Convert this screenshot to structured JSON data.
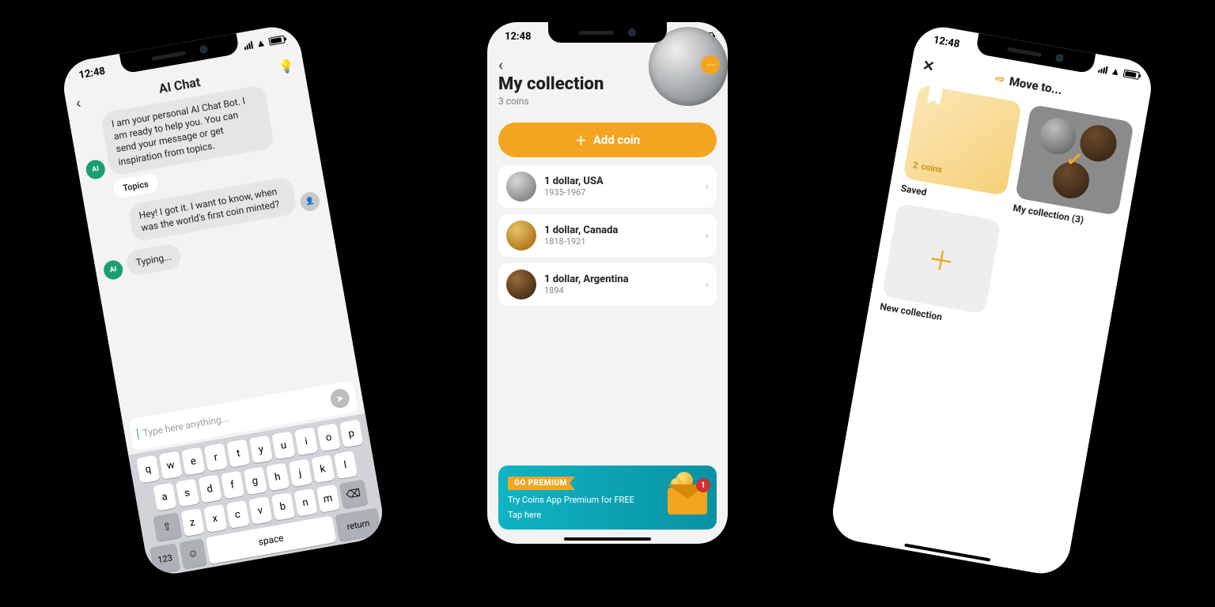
{
  "status_time": "12:48",
  "phone1": {
    "title": "AI Chat",
    "bot_intro": "I am your personal AI Chat Bot. I am ready to help you. You can send your message or get inspiration from topics.",
    "topics_label": "Topics",
    "user_msg": "Hey! I got it. I want to know, when was the world's first coin minted?",
    "typing": "Typing...",
    "placeholder": "Type here anything...",
    "avatar_label": "AI",
    "kb": {
      "row1": [
        "q",
        "w",
        "e",
        "r",
        "t",
        "y",
        "u",
        "i",
        "o",
        "p"
      ],
      "row2": [
        "a",
        "s",
        "d",
        "f",
        "g",
        "h",
        "j",
        "k",
        "l"
      ],
      "row3": [
        "z",
        "x",
        "c",
        "v",
        "b",
        "n",
        "m"
      ],
      "num": "123",
      "space": "space",
      "return": "return"
    }
  },
  "phone2": {
    "title": "My collection",
    "subtitle": "3 coins",
    "add_label": "Add coin",
    "coins": [
      {
        "name": "1 dollar, USA",
        "range": "1935-1967"
      },
      {
        "name": "1 dollar, Canada",
        "range": "1818-1921"
      },
      {
        "name": "1 dollar, Argentina",
        "range": "1894"
      }
    ],
    "premium": {
      "ribbon": "GO PREMIUM",
      "line1": "Try Coins App Premium for FREE",
      "line2": "Tap here",
      "badge": "1"
    }
  },
  "phone3": {
    "title": "Move to...",
    "saved_count": "2",
    "saved_unit": "coins",
    "saved_label": "Saved",
    "mycoll_label": "My collection (3)",
    "new_label": "New collection"
  }
}
